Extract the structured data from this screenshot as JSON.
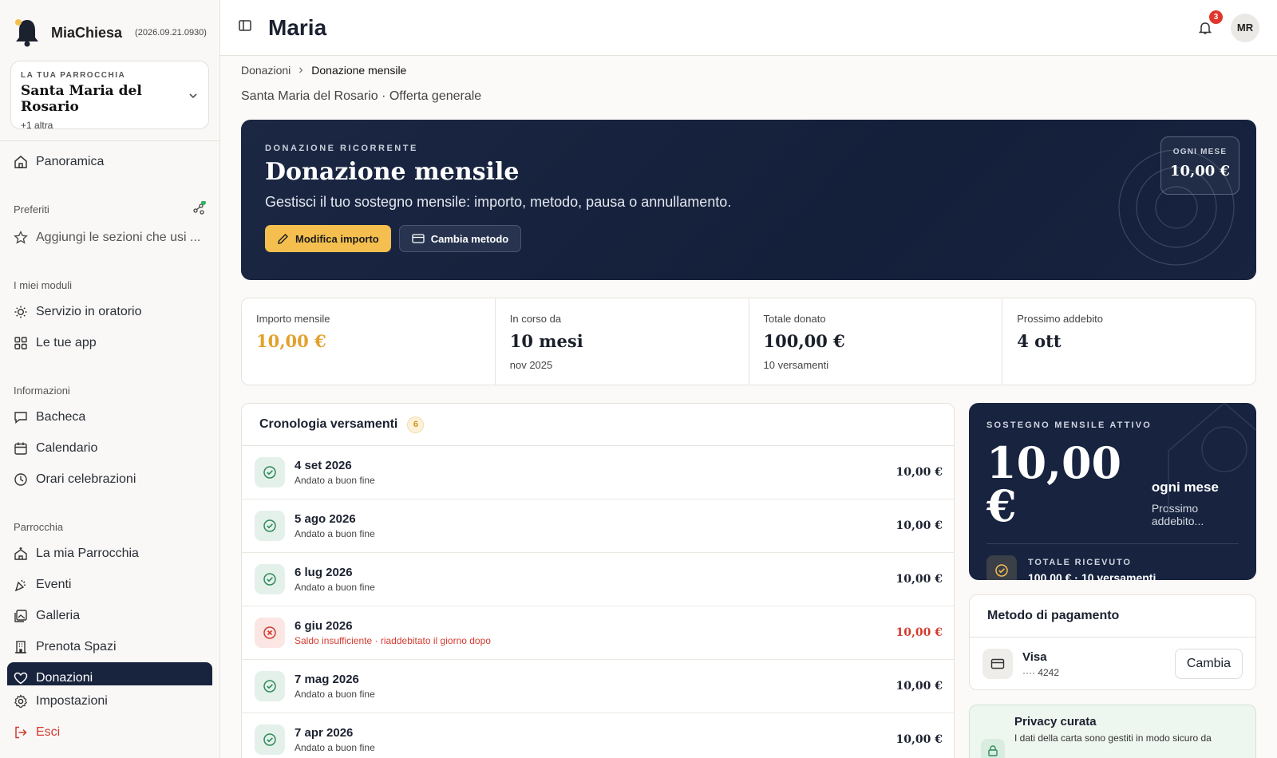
{
  "brand": {
    "name": "MiaChiesa",
    "version": "(2026.09.21.0930)"
  },
  "parish": {
    "kicker": "LA TUA PARROCCHIA",
    "name": "Santa Maria del Rosario",
    "extra": "+1 altra"
  },
  "nav": {
    "overview": "Panoramica",
    "favorites_header": "Preferiti",
    "favorites_add": "Aggiungi le sezioni che usi ...",
    "modules_header": "I miei moduli",
    "modules": [
      "Servizio in oratorio",
      "Le tue app"
    ],
    "info_header": "Informazioni",
    "info": [
      "Bacheca",
      "Calendario",
      "Orari celebrazioni"
    ],
    "parish_header": "Parrocchia",
    "parish": [
      "La mia Parrocchia",
      "Eventi",
      "Galleria",
      "Prenota Spazi",
      "Donazioni"
    ],
    "settings": "Impostazioni",
    "logout": "Esci"
  },
  "topbar": {
    "title": "Maria",
    "notifications": "3",
    "avatar": "MR"
  },
  "breadcrumb": [
    "Donazioni",
    "Donazione mensile"
  ],
  "subtitle": "Santa Maria del Rosario · Offerta generale",
  "hero": {
    "kicker": "DONAZIONE RICORRENTE",
    "title": "Donazione mensile",
    "description": "Gestisci il tuo sostegno mensile: importo, metodo, pausa o annullamento.",
    "edit_button": "Modifica importo",
    "method_button": "Cambia metodo",
    "month_label": "OGNI MESE",
    "month_value": "10,00 €"
  },
  "stats": [
    {
      "label": "Importo mensile",
      "value": "10,00 €",
      "sub": ""
    },
    {
      "label": "In corso da",
      "value": "10 mesi",
      "sub": "nov 2025"
    },
    {
      "label": "Totale donato",
      "value": "100,00 €",
      "sub": "10 versamenti"
    },
    {
      "label": "Prossimo addebito",
      "value": "4 ott",
      "sub": ""
    }
  ],
  "history": {
    "title": "Cronologia versamenti",
    "count": "6",
    "rows": [
      {
        "date": "4 set 2026",
        "status": "Andato a buon fine",
        "amount": "10,00 €",
        "ok": true
      },
      {
        "date": "5 ago 2026",
        "status": "Andato a buon fine",
        "amount": "10,00 €",
        "ok": true
      },
      {
        "date": "6 lug 2026",
        "status": "Andato a buon fine",
        "amount": "10,00 €",
        "ok": true
      },
      {
        "date": "6 giu 2026",
        "status": "Saldo insufficiente · riaddebitato il giorno dopo",
        "amount": "10,00 €",
        "ok": false
      },
      {
        "date": "7 mag 2026",
        "status": "Andato a buon fine",
        "amount": "10,00 €",
        "ok": true
      },
      {
        "date": "7 apr 2026",
        "status": "Andato a buon fine",
        "amount": "10,00 €",
        "ok": true
      }
    ]
  },
  "support": {
    "kicker": "SOSTEGNO MENSILE ATTIVO",
    "amount": "10,00 €",
    "period": "ogni mese",
    "next": "Prossimo addebito...",
    "total_label": "TOTALE RICEVUTO",
    "total_value": "100,00 € · 10 versamenti"
  },
  "payment": {
    "title": "Metodo di pagamento",
    "card": "Visa",
    "number": "···· 4242",
    "change": "Cambia"
  },
  "privacy": {
    "title": "Privacy curata",
    "text": "I dati della carta sono gestiti in modo sicuro da"
  },
  "colors": {
    "navy": "#17233f",
    "gold": "#f4bf4f",
    "danger": "#d33b2f",
    "success": "#2f8a5b"
  }
}
